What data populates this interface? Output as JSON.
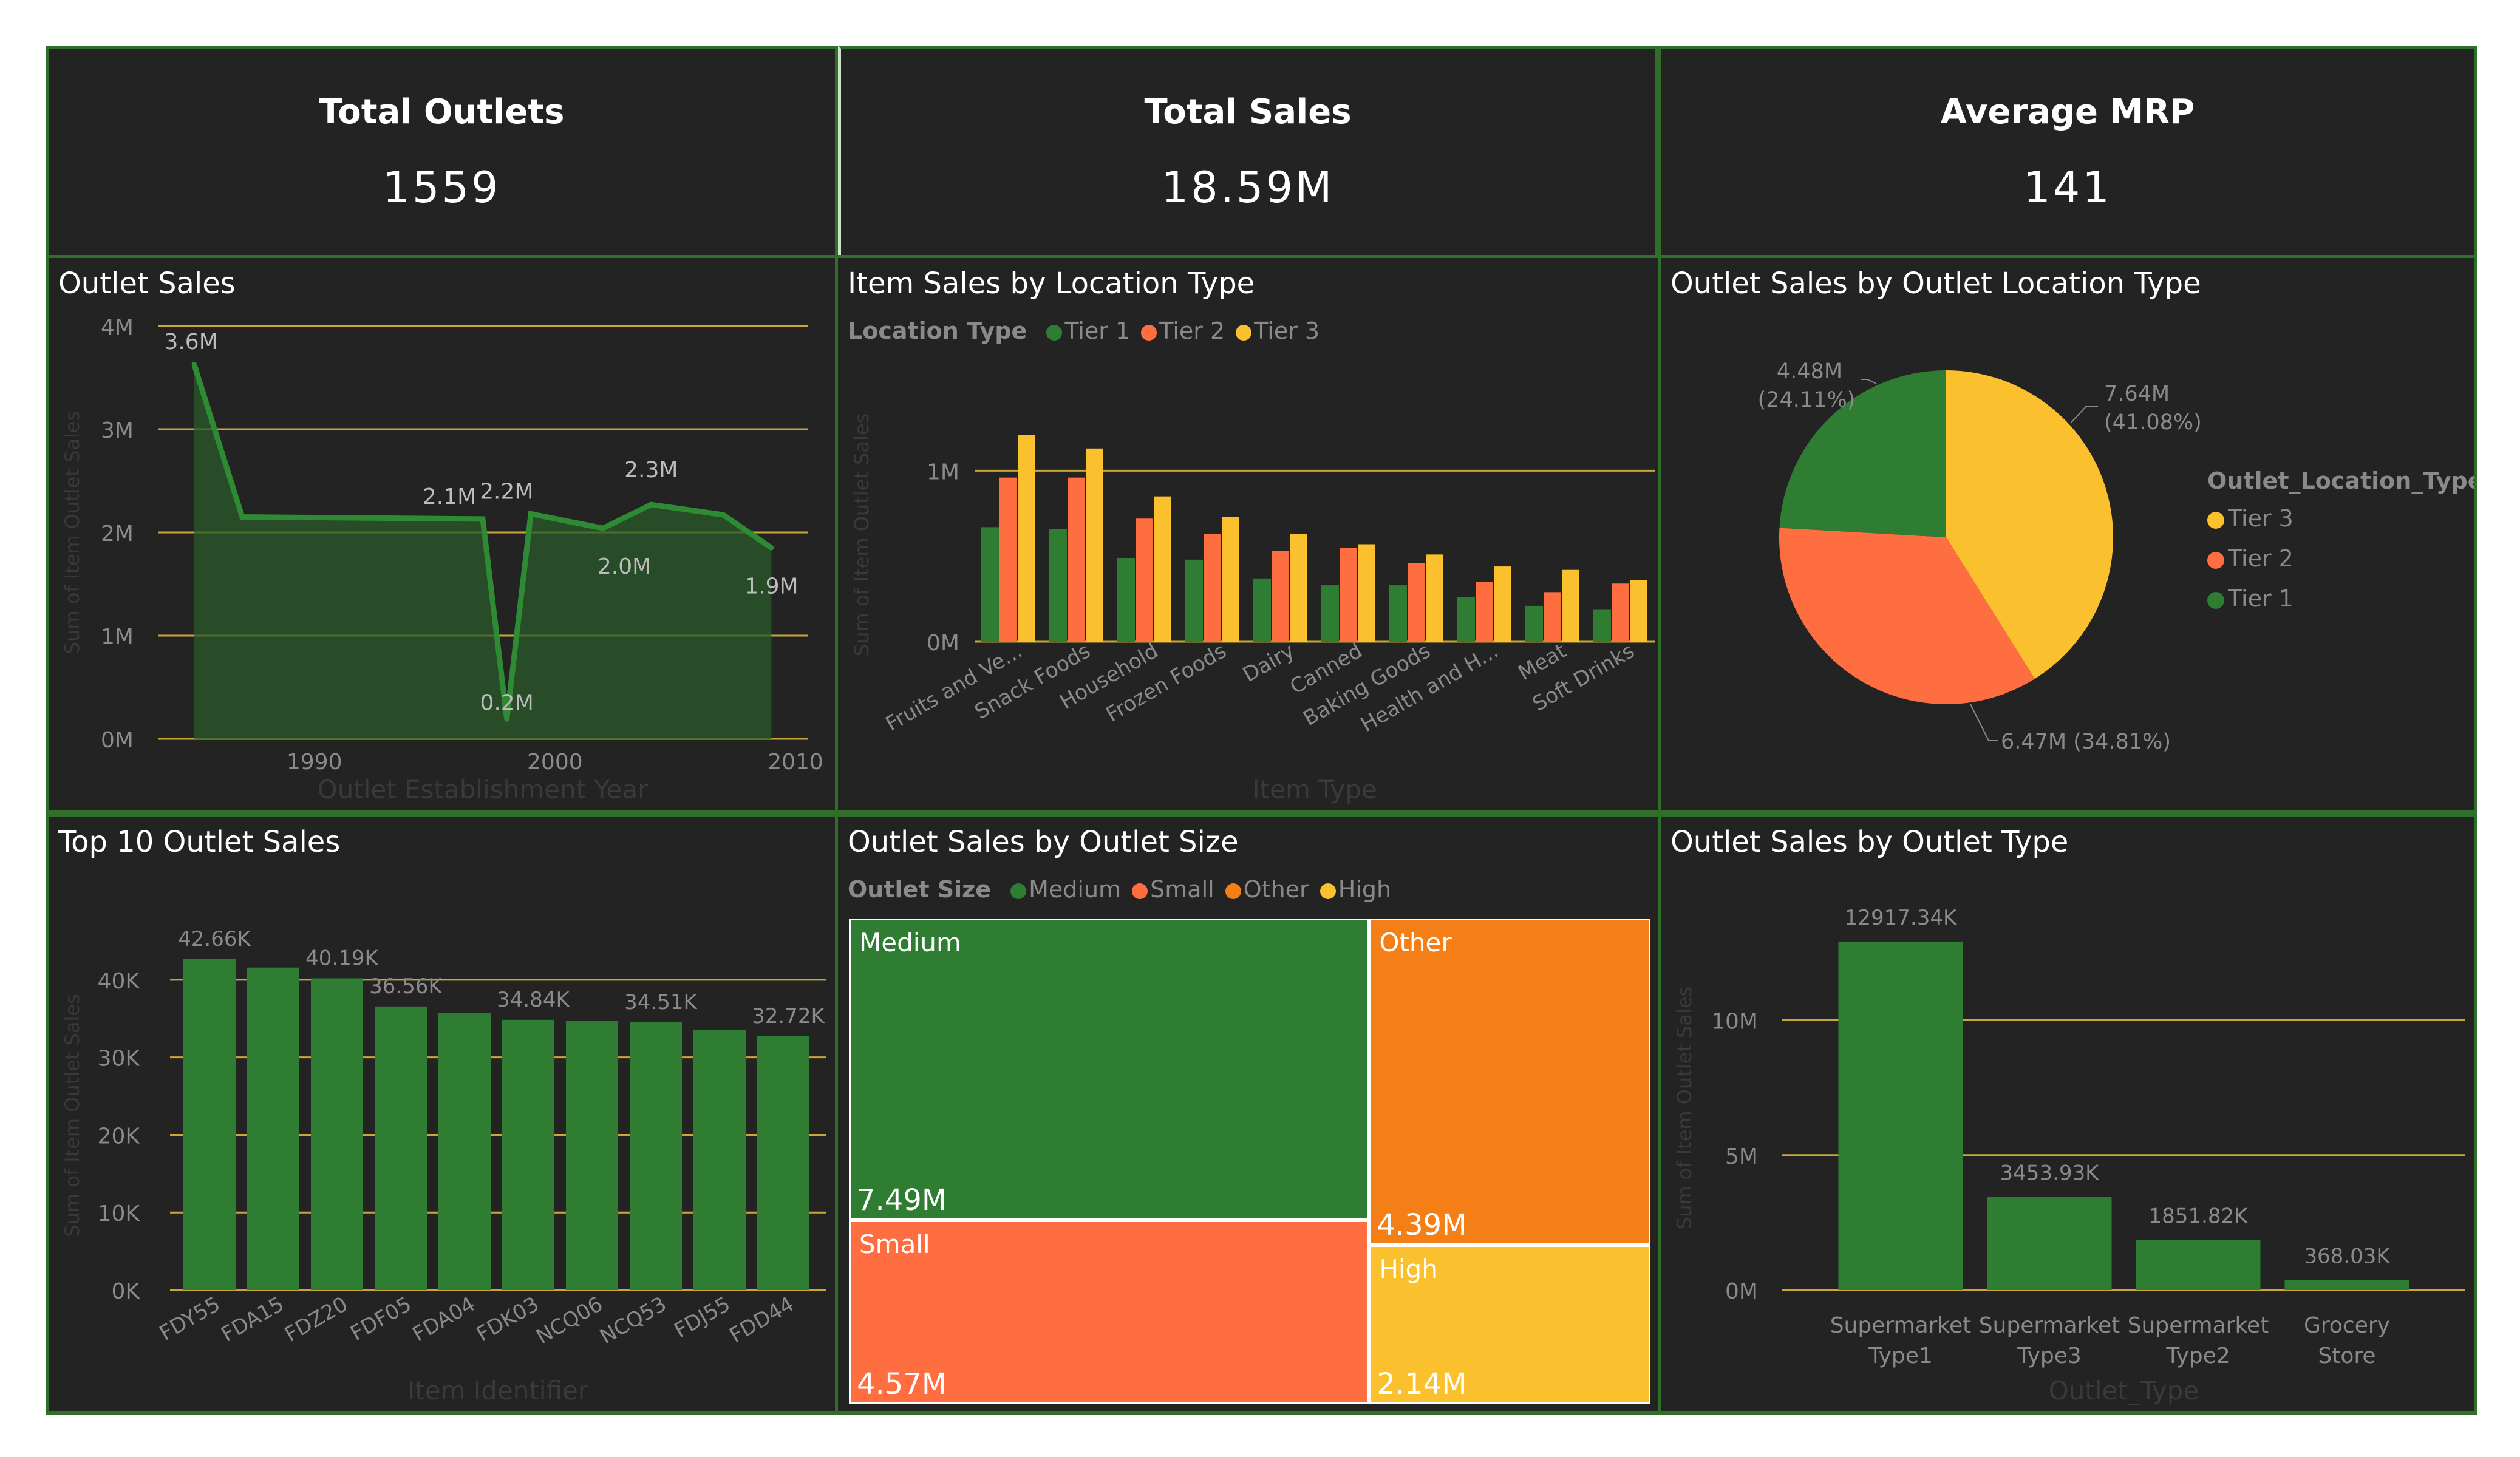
{
  "kpis": [
    {
      "title": "Total Outlets",
      "value": "1559"
    },
    {
      "title": "Total Sales",
      "value": "18.59M"
    },
    {
      "title": "Average MRP",
      "value": "141"
    }
  ],
  "colors": {
    "green": "#2e7d32",
    "red": "#ff6e40",
    "yellow": "#fbc02d",
    "orange": "#f57f17",
    "panel_bg": "#232323",
    "border": "#2f6f2a",
    "gridline": "#c8a83a"
  },
  "outlet_sales": {
    "title": "Outlet Sales",
    "xlabel": "Outlet Establishment Year",
    "ylabel": "Sum of Item Outlet Sales",
    "chart_data": {
      "type": "area",
      "x": [
        1985,
        1987,
        1997,
        1998,
        1999,
        2002,
        2004,
        2007,
        2009
      ],
      "values": [
        3.63,
        2.15,
        2.13,
        0.19,
        2.18,
        2.04,
        2.27,
        2.17,
        1.85
      ],
      "point_labels": [
        "3.6M",
        "",
        "2.1M",
        "0.2M",
        "2.2M",
        "2.0M",
        "2.3M",
        "",
        "1.9M"
      ],
      "ylim": [
        0,
        4
      ],
      "y_ticks": [
        "0M",
        "1M",
        "2M",
        "3M",
        "4M"
      ],
      "x_ticks": [
        "1990",
        "2000",
        "2010"
      ],
      "grid": true
    }
  },
  "item_sales_location": {
    "title": "Item Sales by Location Type",
    "legend_title": "Location Type",
    "series_names": [
      "Tier 1",
      "Tier 2",
      "Tier 3"
    ],
    "xlabel": "Item Type",
    "ylabel": "Sum of Item Outlet Sales",
    "chart_data": {
      "type": "bar",
      "categories": [
        "Fruits and Ve...",
        "Snack Foods",
        "Household",
        "Frozen Foods",
        "Dairy",
        "Canned",
        "Baking Goods",
        "Health and H...",
        "Meat",
        "Soft Drinks"
      ],
      "series": [
        {
          "name": "Tier 1",
          "values": [
            0.67,
            0.66,
            0.49,
            0.48,
            0.37,
            0.33,
            0.33,
            0.26,
            0.21,
            0.19
          ]
        },
        {
          "name": "Tier 2",
          "values": [
            0.96,
            0.96,
            0.72,
            0.63,
            0.53,
            0.55,
            0.46,
            0.35,
            0.29,
            0.34
          ]
        },
        {
          "name": "Tier 3",
          "values": [
            1.21,
            1.13,
            0.85,
            0.73,
            0.63,
            0.57,
            0.51,
            0.44,
            0.42,
            0.36
          ]
        }
      ],
      "ylim": [
        0,
        1.25
      ],
      "y_ticks": [
        "0M",
        "1M"
      ],
      "grid": true
    }
  },
  "pie": {
    "title": "Outlet Sales by Outlet Location Type",
    "legend_title": "Outlet_Location_Type",
    "chart_data": {
      "type": "pie",
      "slices": [
        {
          "name": "Tier 3",
          "value": 7.64,
          "label": "7.64M",
          "pct": "(41.08%)"
        },
        {
          "name": "Tier 2",
          "value": 6.47,
          "label": "6.47M (34.81%)",
          "pct": ""
        },
        {
          "name": "Tier 1",
          "value": 4.48,
          "label": "4.48M",
          "pct": "(24.11%)"
        }
      ]
    }
  },
  "top10": {
    "title": "Top 10 Outlet Sales",
    "xlabel": "Item Identifier",
    "ylabel": "Sum of Item Outlet Sales",
    "chart_data": {
      "type": "bar",
      "categories": [
        "FDY55",
        "FDA15",
        "FDZ20",
        "FDF05",
        "FDA04",
        "FDK03",
        "NCQ06",
        "NCQ53",
        "FDJ55",
        "FDD44"
      ],
      "values": [
        42.66,
        41.58,
        40.19,
        36.56,
        35.74,
        34.84,
        34.69,
        34.51,
        33.53,
        32.72
      ],
      "data_labels": [
        "42.66K",
        "",
        "40.19K",
        "36.56K",
        "",
        "34.84K",
        "",
        "34.51K",
        "",
        "32.72K"
      ],
      "ylim": [
        0,
        45
      ],
      "y_ticks": [
        "0K",
        "10K",
        "20K",
        "30K",
        "40K"
      ],
      "grid": true
    }
  },
  "treemap": {
    "title": "Outlet Sales by Outlet Size",
    "legend_title": "Outlet Size",
    "legend": [
      "Medium",
      "Small",
      "Other",
      "High"
    ],
    "chart_data": {
      "type": "treemap",
      "items": [
        {
          "name": "Medium",
          "value": 7.49,
          "label": "7.49M"
        },
        {
          "name": "Small",
          "value": 4.57,
          "label": "4.57M"
        },
        {
          "name": "Other",
          "value": 4.39,
          "label": "4.39M"
        },
        {
          "name": "High",
          "value": 2.14,
          "label": "2.14M"
        }
      ]
    }
  },
  "outlet_type": {
    "title": "Outlet Sales by Outlet Type",
    "xlabel": "Outlet_Type",
    "ylabel": "Sum of Item Outlet Sales",
    "chart_data": {
      "type": "bar",
      "categories": [
        [
          "Supermarket",
          "Type1"
        ],
        [
          "Supermarket",
          "Type3"
        ],
        [
          "Supermarket",
          "Type2"
        ],
        [
          "Grocery",
          "Store"
        ]
      ],
      "values": [
        12917.34,
        3453.93,
        1851.82,
        368.03
      ],
      "data_labels": [
        "12917.34K",
        "3453.93K",
        "1851.82K",
        "368.03K"
      ],
      "ylim": [
        0,
        13500
      ],
      "y_ticks": [
        "0M",
        "5M",
        "10M"
      ],
      "grid": true
    }
  }
}
